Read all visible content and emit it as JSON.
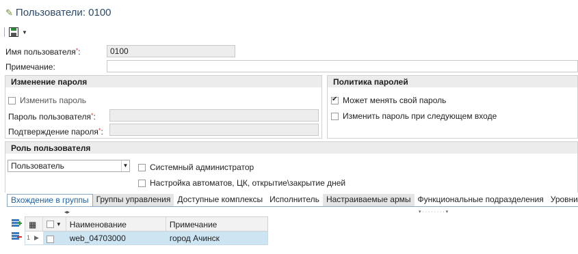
{
  "window": {
    "title": "Пользователи: 0100"
  },
  "toolbar": {
    "save_icon": "save-icon",
    "dropdown_icon": "chevron-down-icon"
  },
  "form": {
    "username_label": "Имя пользователя",
    "username_value": "0100",
    "note_label": "Примечание:",
    "note_value": "",
    "required_mark": "*"
  },
  "password_change": {
    "title": "Изменение пароля",
    "change_label": "Изменить пароль",
    "change_checked": false,
    "password_label": "Пароль пользователя",
    "password_value": "",
    "confirm_label": "Подтверждение пароля",
    "confirm_value": ""
  },
  "password_policy": {
    "title": "Политика паролей",
    "can_change_label": "Может менять свой пароль",
    "can_change_checked": true,
    "change_next_label": "Изменить пароль при следующем входе",
    "change_next_checked": false
  },
  "role": {
    "title": "Роль пользователя",
    "selected": "Пользователь",
    "sysadmin_label": "Системный администратор",
    "sysadmin_checked": false,
    "automata_label": "Настройка автоматов, ЦК, открытие\\закрытие дней",
    "automata_checked": false
  },
  "tabs": [
    {
      "label": "Вхождение в группы",
      "active": true
    },
    {
      "label": "Группы управления",
      "active": false
    },
    {
      "label": "Доступные комплексы",
      "active": false
    },
    {
      "label": "Исполнитель",
      "active": false
    },
    {
      "label": "Настраиваемые армы",
      "active": false
    },
    {
      "label": "Функциональные подразделения",
      "active": false
    },
    {
      "label": "Уровни ЭП",
      "active": false
    }
  ],
  "grid": {
    "columns": [
      "Наименование",
      "Примечание"
    ],
    "rows": [
      {
        "num": "1",
        "name": "web_04703000",
        "note": "город Ачинск",
        "checked": false
      }
    ]
  },
  "colors": {
    "accent": "#1f5f9e",
    "selection": "#cde4f3",
    "required": "#e03131"
  }
}
